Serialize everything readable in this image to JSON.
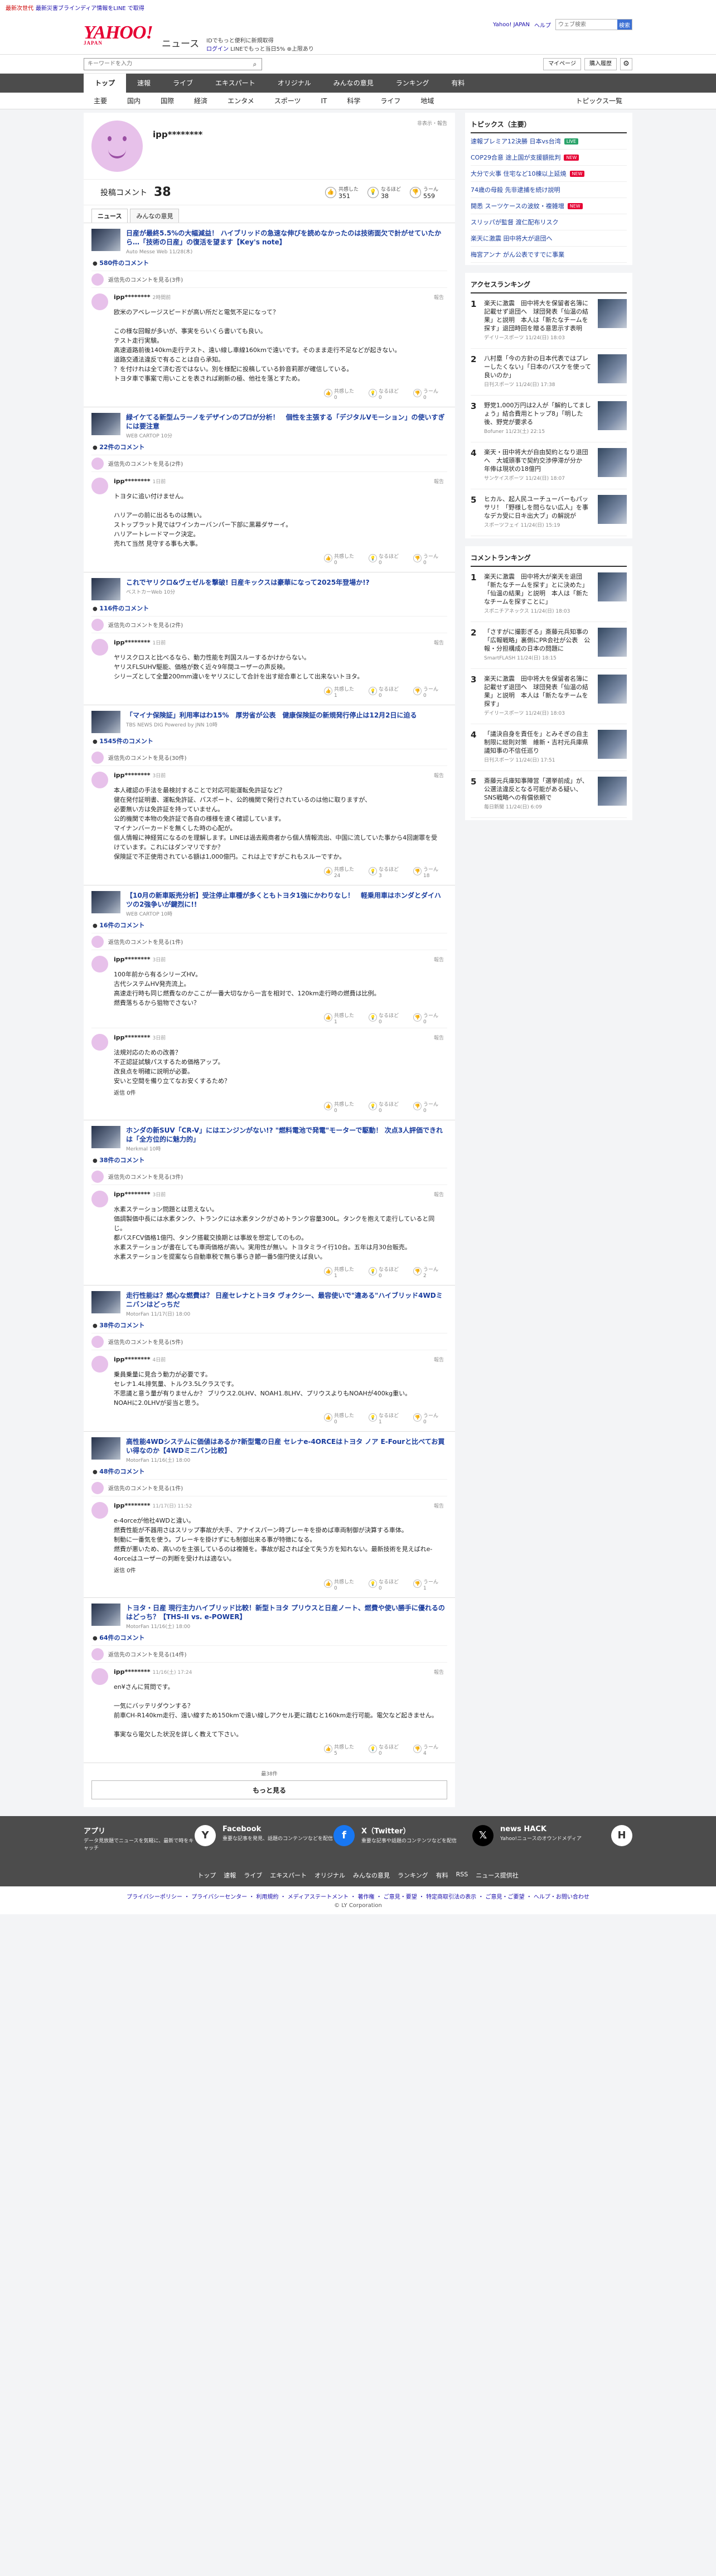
{
  "top_strip": {
    "badge": "最新次世代",
    "text": "最新災害ブラインディア情報をLINE で取得"
  },
  "header": {
    "logo": "YAHOO!",
    "logo_sub": "JAPAN",
    "news": "ニュース",
    "pr1": "IDでもっと便利に新規取得",
    "pr2": "ログイン",
    "pr3": "LINEでもっと当日5% ⊕上限あり",
    "links": [
      "Yahoo! JAPAN",
      "ヘルプ"
    ],
    "search_placeholder": "ウェブ検索",
    "search_btn": "検索"
  },
  "search": {
    "placeholder": "キーワードを入力",
    "mypage": "マイページ",
    "paid": "購入履歴"
  },
  "nav1": [
    "トップ",
    "速報",
    "ライブ",
    "エキスパート",
    "オリジナル",
    "みんなの意見",
    "ランキング",
    "有料"
  ],
  "nav2": [
    "主要",
    "国内",
    "国際",
    "経済",
    "エンタメ",
    "スポーツ",
    "IT",
    "科学",
    "ライフ",
    "地域"
  ],
  "nav2_all": "トピックス一覧",
  "profile": {
    "name": "ipp********",
    "pv": "非表示・報告",
    "comments_label": "投稿コメント",
    "comments_count": "38",
    "agree_label": "共感した",
    "agree": "351",
    "under_label": "なるほど",
    "under": "38",
    "hmm_label": "うーん",
    "hmm": "559",
    "tabs": [
      "ニュース",
      "みんなの意見"
    ]
  },
  "reply_text": "返信先のコメントを見る",
  "reply_label": "返信",
  "report": "報告",
  "react_labels": [
    "共感した",
    "なるほど",
    "うーん"
  ],
  "blocks": [
    {
      "title": "日産が最終5.5%の大幅減益！ ハイブリッドの急速な伸びを読めなかったのは技術面欠で計がせていたから…「技術の日産」の復活を望ます【Key's note】",
      "src": "Auto Messe Web 11/28(木)",
      "count": "580件のコメント",
      "reply_count": "返信先のコメントを見る(3件)",
      "comments": [
        {
          "user": "ipp********",
          "time": "2時間前",
          "text": "欧米のアベレージスピードが高い所だと電気不足になって？\n\nこの様な回報が多いが、事実をらいくら書いても良い。\nテスト走行実験。\n高速道路前後140km走行テスト、遠い線し車線160kmで遠いです。そのまま走行不足などが起きない。\n道路交通法違反で有ることは自ら承知。\n？を付けれは全て済む否ではない。別を様配に投稿している鈴音莉那が確信している。\nトヨタ車で事案で用いことを表されば刷新の極、他社を落とすため。",
          "r": [
            "0",
            "0",
            "0"
          ]
        }
      ]
    },
    {
      "title": "緑イケてる新型ムラーノをデザインのプロが分析！　個性を主張する「デジタルVモーション」の使いすぎには要注意",
      "src": "WEB CARTOP 10分",
      "count": "22件のコメント",
      "reply_count": "返信先のコメントを見る(2件)",
      "comments": [
        {
          "user": "ipp********",
          "time": "1日前",
          "text": "トヨタに追い付けません。\n\nハリアーの前に出るものは無い。\nストップラット見ではワインカーバンパー下部に黒幕ダサーイ。\nハリアートレードマーク決定。\n売れて当然 見守する事も大事。",
          "r": [
            "0",
            "0",
            "0"
          ]
        }
      ]
    },
    {
      "title": "これでヤリクロ&ヴェゼルを撃破! 日産キックスは豪華になって2025年登場か!?",
      "src": "ベストカーWeb 10分",
      "count": "116件のコメント",
      "reply_count": "返信先のコメントを見る(2件)",
      "comments": [
        {
          "user": "ipp********",
          "time": "1日前",
          "text": "ヤリスクロスと比べるなら、動力性能を判国スルーするかけからない。\nヤリスFLSUHV駆能、価格が数く近々9年間ユーザーの声反映。\nシリーズとして全量200mm違いをヤリスにして合計を出す総合車として出来ないトヨタ。",
          "r": [
            "1",
            "0",
            "0"
          ]
        }
      ]
    },
    {
      "title": "「マイナ保険証」利用率はわ15%　厚労省が公表　健康保険証の新規発行停止は12月2日に迫る",
      "src": "TBS NEWS DIG Powered by JNN 10時",
      "count": "1545件のコメント",
      "reply_count": "返信先のコメントを見る(30件)",
      "comments": [
        {
          "user": "ipp********",
          "time": "3日前",
          "text": "本人確認の手法を最検討することで対応可能運転免許証など？\n健在発付証明書、運転免許証、パスポート、公的機関で発行されているのは他に取りますが、\n必要無い方は免許証を持っていません。\n公的機関で本物の免許証で各自の様様を速く確認しています。\nマイナンバーカードを無くした時の心配が。\n個人情報に神経質になるのを理解します。LINEは過去殿商者から個人情報流出、中国に流していた事から4回謝罪を受けています。これにはダンマリですか？\n保険証で不正使用されている額は1,000億円。これは上ですがこれもスルーですか。",
          "r": [
            "24",
            "3",
            "18"
          ]
        }
      ]
    },
    {
      "title": "【10月の新車販売分析】受注停止車種が多くともトヨタ1強にかわりなし！　軽乗用車はホンダとダイハツの2強争いが鍵烈に!!",
      "src": "WEB CARTOP 10時",
      "count": "16件のコメント",
      "reply_count": "返信先のコメントを見る(1件)",
      "comments": [
        {
          "user": "ipp********",
          "time": "3日前",
          "text": "100年前から有るシリーズHV。\n古代システムHV発売流上。\n高速走行時も同じ燃費なのかここが一番大切なから一言を相対で、120km走行時の燃費は比例。\n燃費落ちるから狙物でさない？",
          "r": [
            "1",
            "0",
            "0"
          ]
        },
        {
          "user": "ipp********",
          "time": "3日前",
          "text": "法規対応のための改善？\n不正認証試験パスするため価格アップ。\n改良点を明確に説明が必要。\n安いと空間を備り立てなお安くするため？",
          "r": [
            "0",
            "0",
            "0"
          ],
          "reply": "返信 0件"
        }
      ]
    },
    {
      "title": "ホンダの新SUV「CR-V」にはエンジンがない!? \"燃料電池で発電\"モーターで駆動！ 次点3人評価できれは「全方位的に魅力的」",
      "src": "Merkmal 10時",
      "count": "38件のコメント",
      "reply_count": "返信先のコメントを見る(3件)",
      "comments": [
        {
          "user": "ipp********",
          "time": "3日前",
          "text": "水素ステーション問題とは思えない。\n価調製価中長には水素タンク、トランクには水素タンクがさめトランク容量300L。タンクを抱えて走行していると同じ。\n都バスFCV価格1億円、タンク搭載交換期とは事故を想定してのもの。\n水素ステーションが書在しても車両価格が高い。実用性が無い。トヨタミライ行10台。五年は月30台販売。\n水素ステーションを提案なら自動車税で無ら事らき節一番5億円使えば良い。",
          "r": [
            "1",
            "0",
            "2"
          ]
        }
      ]
    },
    {
      "title": "走行性能は？燃心な燃費は？ 日産セレナとトヨタ ヴォクシー、最容使いで\"違ある\"ハイブリッド4WDミニバンはどっちだ",
      "src": "MotorFan 11/17(日) 18:00",
      "count": "38件のコメント",
      "reply_count": "返信先のコメントを見る(5件)",
      "comments": [
        {
          "user": "ipp********",
          "time": "4日前",
          "text": "乗員乗量に見合う動力が必要です。\nセレナ1.4L排気量、トルク3.5Lクラスです。\n不思議と意う量が有りませんか？ ブリウス2.0LHV、NOAH1.8LHV、プリウスよりもNOAHが400kg重い。\nNOAHに2.0LHVが妥当と思う。",
          "r": [
            "0",
            "1",
            "0"
          ]
        }
      ]
    },
    {
      "title": "高性能4WDシステムに価値はあるか?新型電の日産 セレナe-4ORCEはトヨタ ノア E-Fourと比べてお買い得なのか【4WDミニバン比較】",
      "src": "MotorFan 11/16(土) 18:00",
      "count": "48件のコメント",
      "reply_count": "返信先のコメントを見る(1件)",
      "comments": [
        {
          "user": "ipp********",
          "time": "11/17(日) 11:52",
          "text": "e-4orceが他社4WDと違い。\n燃費性能が不器用さはスリップ事故が大手、アナイスパーン時ブレーキを掛めば車両制御が決算する車体。\n制動に一番気を使う。ブレーキを掛けずにも制御出来る事が特徴になる。\n燃費が悪いため、高いのを主張しているのは複雑を。事故が起されば全て失う方を知れない。最新技術を見えばれe-4orceはユーザーの判断を受けれは適ない。",
          "r": [
            "0",
            "0",
            "1"
          ],
          "reply": "返信 0件"
        }
      ]
    },
    {
      "title": "トヨタ・日産 現行主力ハイブリッド比較！新型トヨタ プリウスと日産ノート、燃費や使い勝手に優れるのはどっち？【THS-II vs. e-POWER】",
      "src": "MotorFan 11/16(土) 18:00",
      "count": "64件のコメント",
      "reply_count": "返信先のコメントを見る(14件)",
      "comments": [
        {
          "user": "ipp********",
          "time": "11/16(土) 17:24",
          "text": "en¥さんに質問です。\n\n一気にバッテリダウンする？\n前車CH-R140km走行、遠い線すため150kmで遠い線しアクセル更に踏むと160km走行可能。電欠など起きません。\n\n事実なら電欠した状況を詳しく教えて下さい。",
          "r": [
            "5",
            "0",
            "4"
          ]
        }
      ]
    }
  ],
  "pager": "最38件",
  "more": "もっと見る",
  "side": {
    "topics_title": "トピックス（主要）",
    "topics": [
      {
        "t": "速報プレミア12決勝 日本vs台湾",
        "b": "LIVE",
        "c": "#2aa36a"
      },
      {
        "t": "COP29合意 途上国が支援額批判",
        "b": "NEW",
        "c": "#e60033"
      },
      {
        "t": "大分で火事 住宅など10棟以上延焼",
        "b": "NEW",
        "c": "#e60033"
      },
      {
        "t": "74歳の母殺 先非逮捕を続け説明",
        "b": "",
        "c": ""
      },
      {
        "t": "開悉 スーツケースの波紋・複雑増",
        "b": "NEW",
        "c": "#e60033"
      },
      {
        "t": "スリッパが監督 渡仁配布リスク",
        "b": "",
        "c": ""
      },
      {
        "t": "楽天に激震 田中将大が退団へ",
        "b": "",
        "c": ""
      },
      {
        "t": "梅宮アンナ がん公表ですでに事業",
        "b": "",
        "c": ""
      }
    ],
    "access_title": "アクセスランキング",
    "access": [
      {
        "n": "1",
        "t": "楽天に激震　田中将大を保留者名簿に記載せず退団へ　球団発表「仙温の結果」と説明　本人は「新たなチームを探す」退団時回を贈る意思示す表明",
        "s": "デイリースポーツ 11/24(日) 18:03"
      },
      {
        "n": "2",
        "t": "八村塁「今の方針の日本代表ではプレーしたくない」「日本のバスケを使って良いのか」",
        "s": "日刊スポーツ 11/24(日) 17:38"
      },
      {
        "n": "3",
        "t": "野党1,000万円は2人が「解約してましょう」結合費用とトップ8」「明した後、野党が要求る",
        "s": "Bofuner 11/23(土) 22:15"
      },
      {
        "n": "4",
        "t": "楽天・田中将大が自由契約となり退団へ　大城頭事で契約交渉停滞が分か　年俸は現状の18億円",
        "s": "サンケイスポーツ 11/24(日) 18:07"
      },
      {
        "n": "5",
        "t": "ヒカル、起人民ユーチューバーもパッサリ！「野様しを問らない広人」を事なデカ受に日キ出大ブ」の解説が",
        "s": "スポーツフェイ 11/24(日) 15:19"
      }
    ],
    "comment_title": "コメントランキング",
    "comment_rank": [
      {
        "n": "1",
        "t": "楽天に激震　田中将大が楽天を退団「新たなチームを探す」とに決めた」「仙温の結果」と説明　本人は「新たなチームを探すことに」",
        "s": "スポニチアネックス 11/24(日) 18:03"
      },
      {
        "n": "2",
        "t": "「さすがに撮影ぎる」斎藤元兵知事の「広報戦略」裏側にPR会社が公表　公報・分担構成の日本の問題に",
        "s": "SmartFLASH 11/24(日) 18:15"
      },
      {
        "n": "3",
        "t": "楽天に激震　田中将大を保留者名簿に記載せず退団へ　球団発表「仙温の結果」と説明　本人は「新たなチームを探す」",
        "s": "デイリースポーツ 11/24(日) 18:03"
      },
      {
        "n": "4",
        "t": "「議決自身を責任を」とみそぎの自主制限に総則対策　維新・吉村元兵庫県議知事の不信任巡り",
        "s": "日刊スポーツ 11/24(日) 17:51"
      },
      {
        "n": "5",
        "t": "斎藤元兵庫知事陣営「選挙前成」が、公選法違反となる可能がある疑い、SNS戦略への有償依頼で",
        "s": "毎日新聞 11/24(日) 6:09"
      }
    ]
  },
  "footer": {
    "cards": [
      {
        "h": "アプリ",
        "p": "データ見放題でニュースを気軽に、最新で時をキャッチ",
        "i": "Y"
      },
      {
        "h": "Facebook",
        "p": "重要な記事を発見、話題のコンテンツなどを配信",
        "i": "f"
      },
      {
        "h": "X（Twitter）",
        "p": "重要な記事や話題のコンテンツなどを配信",
        "i": "𝕏"
      },
      {
        "h": "news HACK",
        "p": "Yahoo!ニュースのオウンドメディア",
        "i": "H"
      }
    ],
    "links": [
      "トップ",
      "速報",
      "ライブ",
      "エキスパート",
      "オリジナル",
      "みんなの意見",
      "ランキング",
      "有料",
      "RSS",
      "ニュース提供社"
    ],
    "legal": "プライバシーポリシー ・ プライバシーセンター ・ 利用規約 ・ メディアステートメント ・ 著作権 ・ ご意見・要望 ・ 特定商取引法の表示 ・ ご意見・ご要望 ・ ヘルプ・お問い合わせ",
    "copy": "© LY Corporation"
  }
}
